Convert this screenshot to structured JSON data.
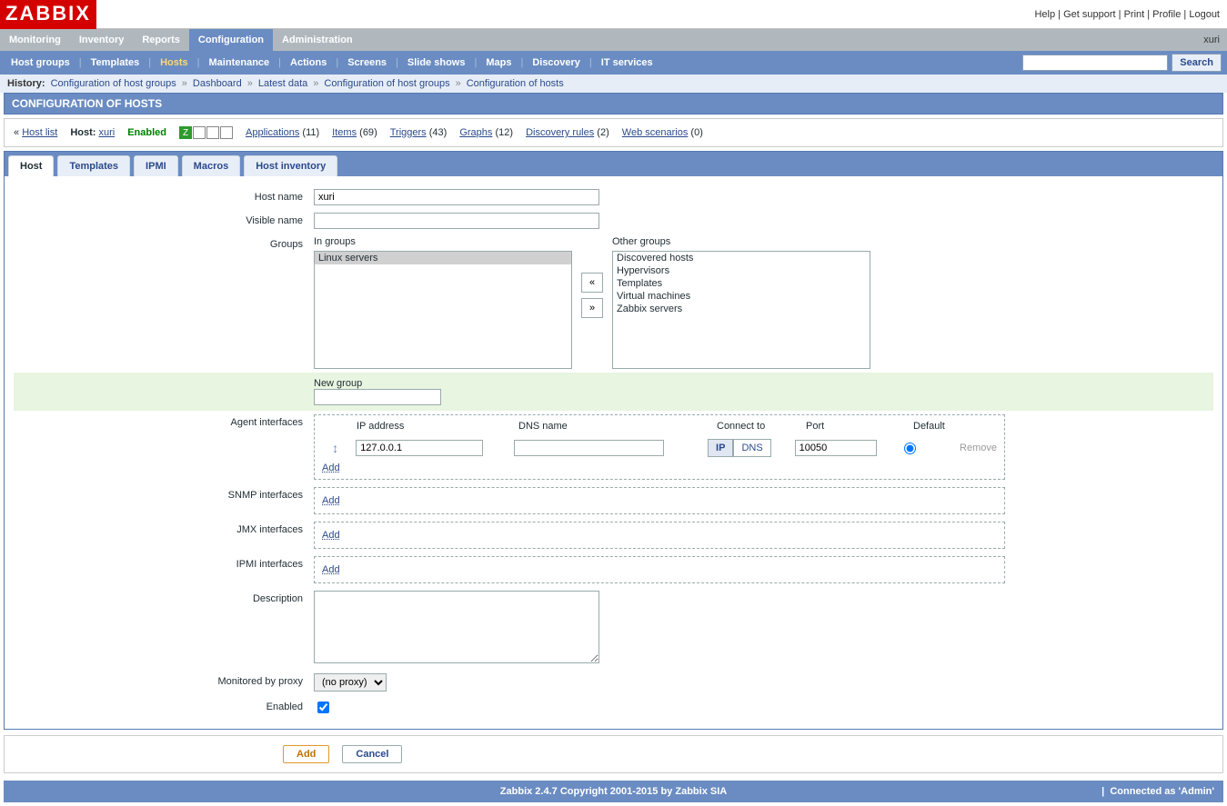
{
  "brand": "ZABBIX",
  "toplinks": {
    "help": "Help",
    "support": "Get support",
    "print": "Print",
    "profile": "Profile",
    "logout": "Logout"
  },
  "menu1": {
    "items": [
      "Monitoring",
      "Inventory",
      "Reports",
      "Configuration",
      "Administration"
    ],
    "active": "Configuration",
    "user": "xuri"
  },
  "menu2": {
    "items": [
      "Host groups",
      "Templates",
      "Hosts",
      "Maintenance",
      "Actions",
      "Screens",
      "Slide shows",
      "Maps",
      "Discovery",
      "IT services"
    ],
    "current": "Hosts",
    "search_btn": "Search"
  },
  "history": {
    "label": "History:",
    "items": [
      "Configuration of host groups",
      "Dashboard",
      "Latest data",
      "Configuration of host groups",
      "Configuration of hosts"
    ]
  },
  "page_title": "CONFIGURATION OF HOSTS",
  "hostbar": {
    "back": "Host list",
    "host_label": "Host:",
    "host_name": "xuri",
    "status": "Enabled",
    "links": [
      {
        "label": "Applications",
        "count": 11
      },
      {
        "label": "Items",
        "count": 69
      },
      {
        "label": "Triggers",
        "count": 43
      },
      {
        "label": "Graphs",
        "count": 12
      },
      {
        "label": "Discovery rules",
        "count": 2
      },
      {
        "label": "Web scenarios",
        "count": 0
      }
    ]
  },
  "tabs": [
    "Host",
    "Templates",
    "IPMI",
    "Macros",
    "Host inventory"
  ],
  "active_tab": "Host",
  "form": {
    "host_name_label": "Host name",
    "host_name_value": "xuri",
    "visible_name_label": "Visible name",
    "visible_name_value": "",
    "groups_label": "Groups",
    "in_groups_label": "In groups",
    "other_groups_label": "Other groups",
    "in_groups": [
      "Linux servers"
    ],
    "other_groups": [
      "Discovered hosts",
      "Hypervisors",
      "Templates",
      "Virtual machines",
      "Zabbix servers"
    ],
    "new_group_label": "New group",
    "agent_if_label": "Agent interfaces",
    "iface_headers": {
      "ip": "IP address",
      "dns": "DNS name",
      "connect": "Connect to",
      "port": "Port",
      "default": "Default",
      "remove": "Remove"
    },
    "agent_if": {
      "ip": "127.0.0.1",
      "dns": "",
      "connect": "IP",
      "port": "10050",
      "default": true
    },
    "conn_ip": "IP",
    "conn_dns": "DNS",
    "add_link": "Add",
    "snmp_if_label": "SNMP interfaces",
    "jmx_if_label": "JMX interfaces",
    "ipmi_if_label": "IPMI interfaces",
    "description_label": "Description",
    "description_value": "",
    "proxy_label": "Monitored by proxy",
    "proxy_value": "(no proxy)",
    "enabled_label": "Enabled",
    "enabled_value": true
  },
  "actions": {
    "add": "Add",
    "cancel": "Cancel"
  },
  "footer": {
    "center": "Zabbix 2.4.7 Copyright 2001-2015 by Zabbix SIA",
    "right": "Connected as 'Admin'"
  }
}
